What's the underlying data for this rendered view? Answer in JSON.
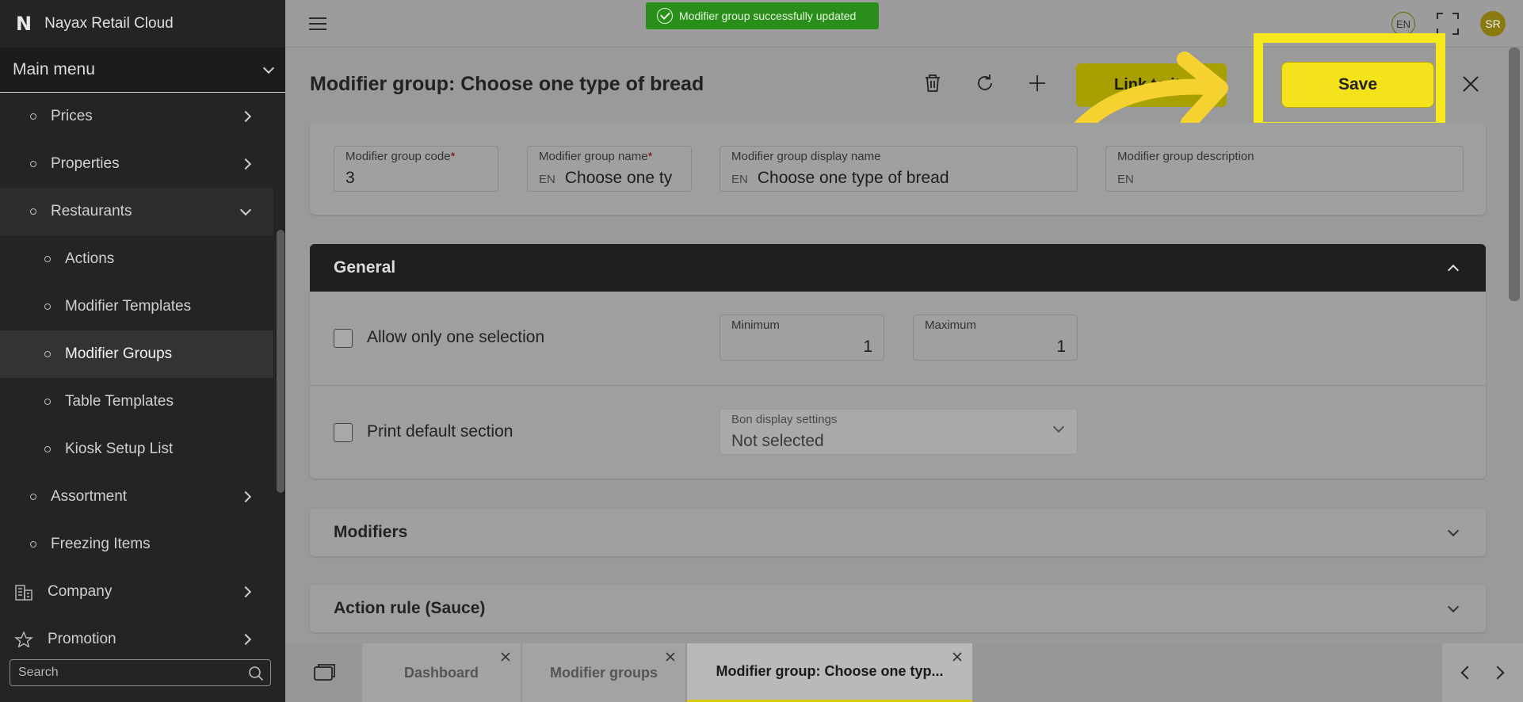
{
  "app": {
    "logo": "N",
    "name": "Nayax Retail Cloud"
  },
  "sidebar": {
    "main_menu": "Main menu",
    "items": [
      {
        "label": "Prices"
      },
      {
        "label": "Properties"
      },
      {
        "label": "Restaurants"
      },
      {
        "label": "Actions"
      },
      {
        "label": "Modifier Templates"
      },
      {
        "label": "Modifier Groups"
      },
      {
        "label": "Table Templates"
      },
      {
        "label": "Kiosk Setup List"
      },
      {
        "label": "Assortment"
      },
      {
        "label": "Freezing Items"
      },
      {
        "label": "Company"
      },
      {
        "label": "Promotion"
      }
    ],
    "search_placeholder": "Search"
  },
  "topbar": {
    "toast": "Modifier group successfully updated",
    "language": "EN",
    "avatar_initials": "SR"
  },
  "page": {
    "title": "Modifier group: Choose one type of bread",
    "link_button": "Link to it",
    "save_button": "Save"
  },
  "fields": {
    "code": {
      "label": "Modifier group code",
      "value": "3"
    },
    "name": {
      "label": "Modifier group name",
      "lang": "EN",
      "value": "Choose one ty"
    },
    "display_name": {
      "label": "Modifier group display name",
      "lang": "EN",
      "value": "Choose one type of bread"
    },
    "description": {
      "label": "Modifier group description",
      "lang": "EN",
      "value": ""
    },
    "required_mark": "*"
  },
  "general": {
    "title": "General",
    "allow_one": "Allow only one selection",
    "minimum": {
      "label": "Minimum",
      "value": "1"
    },
    "maximum": {
      "label": "Maximum",
      "value": "1"
    },
    "print_default": "Print default section",
    "bon_display": {
      "label": "Bon display settings",
      "value": "Not selected"
    }
  },
  "sections": {
    "modifiers": "Modifiers",
    "action_rule": "Action rule (Sauce)"
  },
  "tabs": [
    {
      "label": "Dashboard"
    },
    {
      "label": "Modifier groups"
    },
    {
      "label": "Modifier group: Choose one typ..."
    }
  ],
  "colors": {
    "accent": "#f4e21a",
    "toast": "#2a8f1a",
    "sidebar": "#242424"
  }
}
